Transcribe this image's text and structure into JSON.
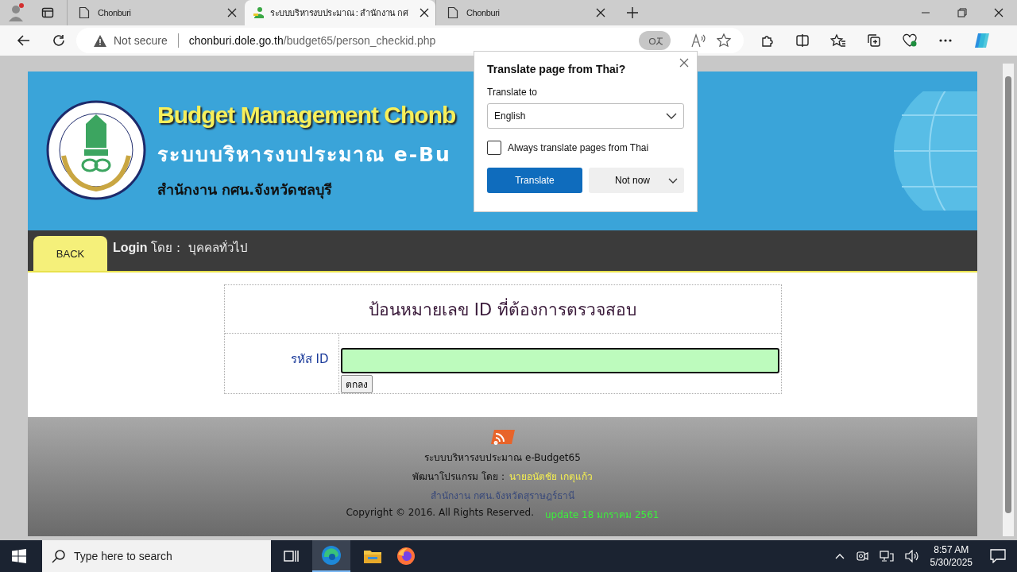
{
  "browser": {
    "tabs": [
      {
        "title": "Chonburi",
        "selected": false,
        "kind": "page"
      },
      {
        "title": "ระบบบริหารงบประมาณ : สำนักงาน กศ",
        "selected": true,
        "kind": "site"
      },
      {
        "title": "Chonburi",
        "selected": false,
        "kind": "page"
      }
    ],
    "address": {
      "security": "Not secure",
      "host": "chonburi.dole.go.th",
      "path": "/budget65/person_checkid.php"
    },
    "translate_popup": {
      "title": "Translate page from Thai?",
      "label": "Translate to",
      "language": "English",
      "always": {
        "label": "Always translate pages from Thai",
        "checked": false
      },
      "primary": "Translate",
      "secondary": "Not now"
    }
  },
  "page": {
    "header": {
      "title": "Budget Management Chonb",
      "subtitle": "ระบบบริหารงบประมาณ e-Bu",
      "office": "สำนักงาน กศน.จังหวัดชลบุรี"
    },
    "nav": {
      "back": "BACK",
      "login": "Login",
      "by": "โดย :",
      "user": "บุคคลทั่วไป"
    },
    "form": {
      "heading": "ป้อนหมายเลข ID ที่ต้องการตรวจสอบ",
      "field_label": "รหัส ID",
      "submit": "ตกลง"
    },
    "footer": {
      "system": "ระบบบริหารงบประมาณ e-Budget65",
      "dev_label": "พัฒนาโปรแกรม โดย :",
      "dev_name": "นายอนัตชัย เกตุแก้ว",
      "office": "สำนักงาน กศน.จังหวัดสุราษฎร์ธานี",
      "copyright": "Copyright © 2016. All Rights Reserved.",
      "update": "update 18 มกราคม 2561"
    }
  },
  "taskbar": {
    "search_placeholder": "Type here to search",
    "time": "8:57 AM",
    "date": "5/30/2025"
  }
}
